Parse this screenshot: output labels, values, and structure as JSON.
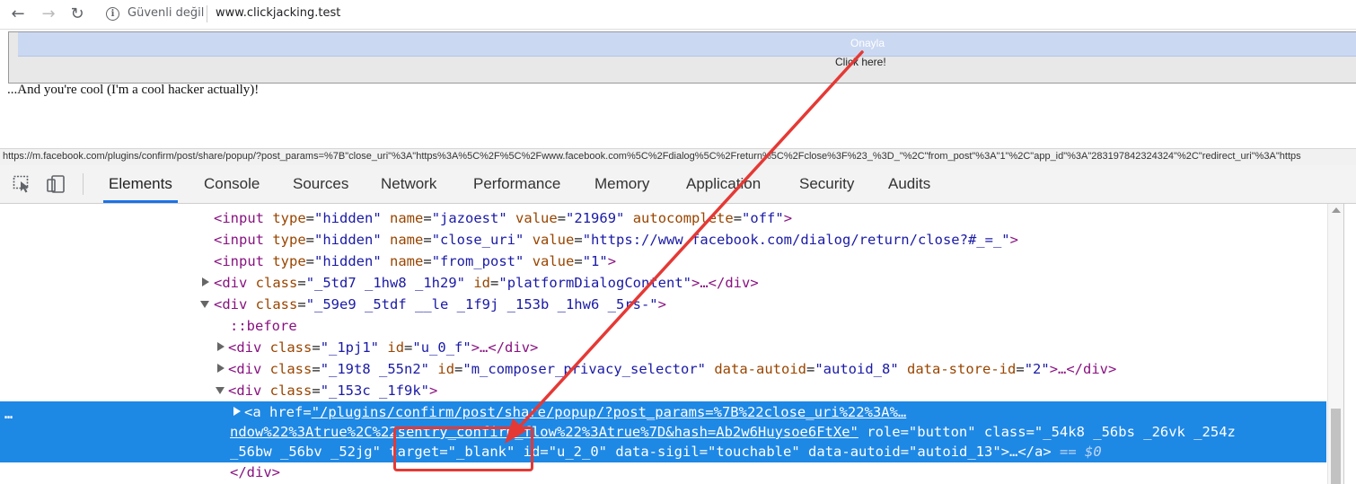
{
  "browser": {
    "security_label": "Güvenli değil",
    "url": "www.clickjacking.test"
  },
  "page": {
    "frame_button_label": "Onayla",
    "click_here_label": "Click here!",
    "cool_text": "...And you're cool (I'm a cool hacker actually)!",
    "status_url": "https://m.facebook.com/plugins/confirm/post/share/popup/?post_params=%7B\"close_uri\"%3A\"https%3A%5C%2F%5C%2Fwww.facebook.com%5C%2Fdialog%5C%2Freturn%5C%2Fclose%3F%23_%3D_\"%2C\"from_post\"%3A\"1\"%2C\"app_id\"%3A\"283197842324324\"%2C\"redirect_uri\"%3A\"https"
  },
  "devtools": {
    "tabs": [
      "Elements",
      "Console",
      "Sources",
      "Network",
      "Performance",
      "Memory",
      "Application",
      "Security",
      "Audits"
    ],
    "active_tab": "Elements",
    "dom": {
      "l1": {
        "tag": "<input",
        "a1": "type",
        "v1": "\"hidden\"",
        "a2": "name",
        "v2": "\"jazoest\"",
        "a3": "value",
        "v3": "\"21969\"",
        "a4": "autocomplete",
        "v4": "\"off\"",
        "end": ">"
      },
      "l2": {
        "tag": "<input",
        "a1": "type",
        "v1": "\"hidden\"",
        "a2": "name",
        "v2": "\"close_uri\"",
        "a3": "value",
        "v3": "\"https://www.facebook.com/dialog/return/close?#_=_\"",
        "end": ">"
      },
      "l3": {
        "tag": "<input",
        "a1": "type",
        "v1": "\"hidden\"",
        "a2": "name",
        "v2": "\"from_post\"",
        "a3": "value",
        "v3": "\"1\"",
        "end": ">"
      },
      "l4": {
        "tag": "<div",
        "a1": "class",
        "v1": "\"_5td7 _1hw8 _1h29\"",
        "a2": "id",
        "v2": "\"platformDialogContent\"",
        "end": ">…</div>"
      },
      "l5": {
        "tag": "<div",
        "a1": "class",
        "v1": "\"_59e9 _5tdf __le _1f9j _153b _1hw6 _5rs-\"",
        "end": ">"
      },
      "l6": {
        "pseudo": "::before"
      },
      "l7": {
        "tag": "<div",
        "a1": "class",
        "v1": "\"_1pj1\"",
        "a2": "id",
        "v2": "\"u_0_f\"",
        "end": ">…</div>"
      },
      "l8": {
        "tag": "<div",
        "a1": "class",
        "v1": "\"_19t8 _55n2\"",
        "a2": "id",
        "v2": "\"m_composer_privacy_selector\"",
        "a3": "data-autoid",
        "v3": "\"autoid_8\"",
        "a4": "data-store-id",
        "v4": "\"2\"",
        "end": ">…</div>"
      },
      "l9": {
        "tag": "<div",
        "a1": "class",
        "v1": "\"_153c _1f9k\"",
        "end": ">"
      },
      "sel1": {
        "tag": "<a",
        "a1": "href",
        "v1": "\"/plugins/confirm/post/share/popup/?post_params=%7B%22close_uri%22%3A%…"
      },
      "sel2": {
        "v1": "ndow%22%3Atrue%2C%22sentry_confirm_flow%22%3Atrue%7D&hash=Ab2w6Huysoe6FtXe\"",
        "a2": "role",
        "v2": "\"button\"",
        "a3": "class",
        "v3": "\"_54k8 _56bs _26vk _254z"
      },
      "sel3": {
        "v1": "_56bw _56bv _52jg\"",
        "a2": "target",
        "v2": "\"_blank\"",
        "a3": "id",
        "v3": "\"u_2_0\"",
        "a4": "data-sigil",
        "v4": "\"touchable\"",
        "a5": "data-autoid",
        "v5": "\"autoid_13\"",
        "end": ">…</a>",
        "eq": "== $0"
      },
      "l10": {
        "tag": "</div>"
      }
    },
    "selected_node_menu": "…"
  },
  "annotation": {
    "color": "#e53935"
  }
}
